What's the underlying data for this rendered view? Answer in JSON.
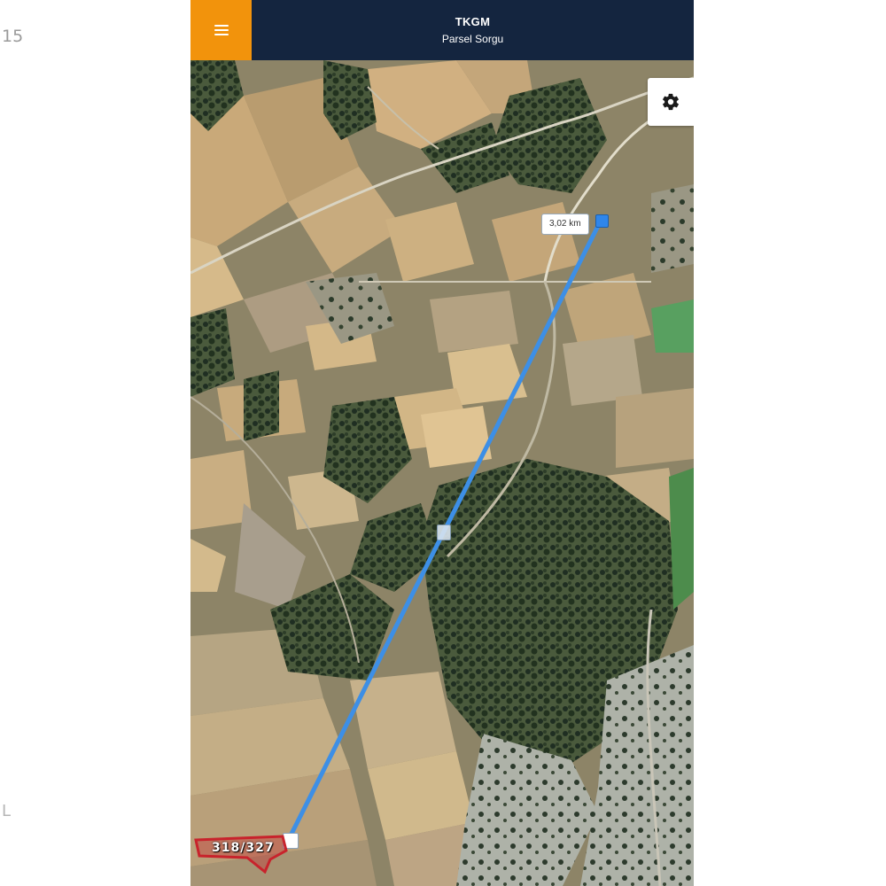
{
  "side": {
    "left_number": "15",
    "bottom_letter": "L"
  },
  "header": {
    "title": "TKGM",
    "subtitle": "Parsel Sorgu"
  },
  "icons": {
    "menu": "hamburger-icon",
    "settings": "gear-icon"
  },
  "colors": {
    "header_bg": "#14253f",
    "menu_bg": "#f2930c",
    "measure_line": "#3d8fe6",
    "parcel_red": "#c8232c"
  },
  "measurement": {
    "distance": "3,02 km"
  },
  "parcel": {
    "label": "318/327"
  }
}
